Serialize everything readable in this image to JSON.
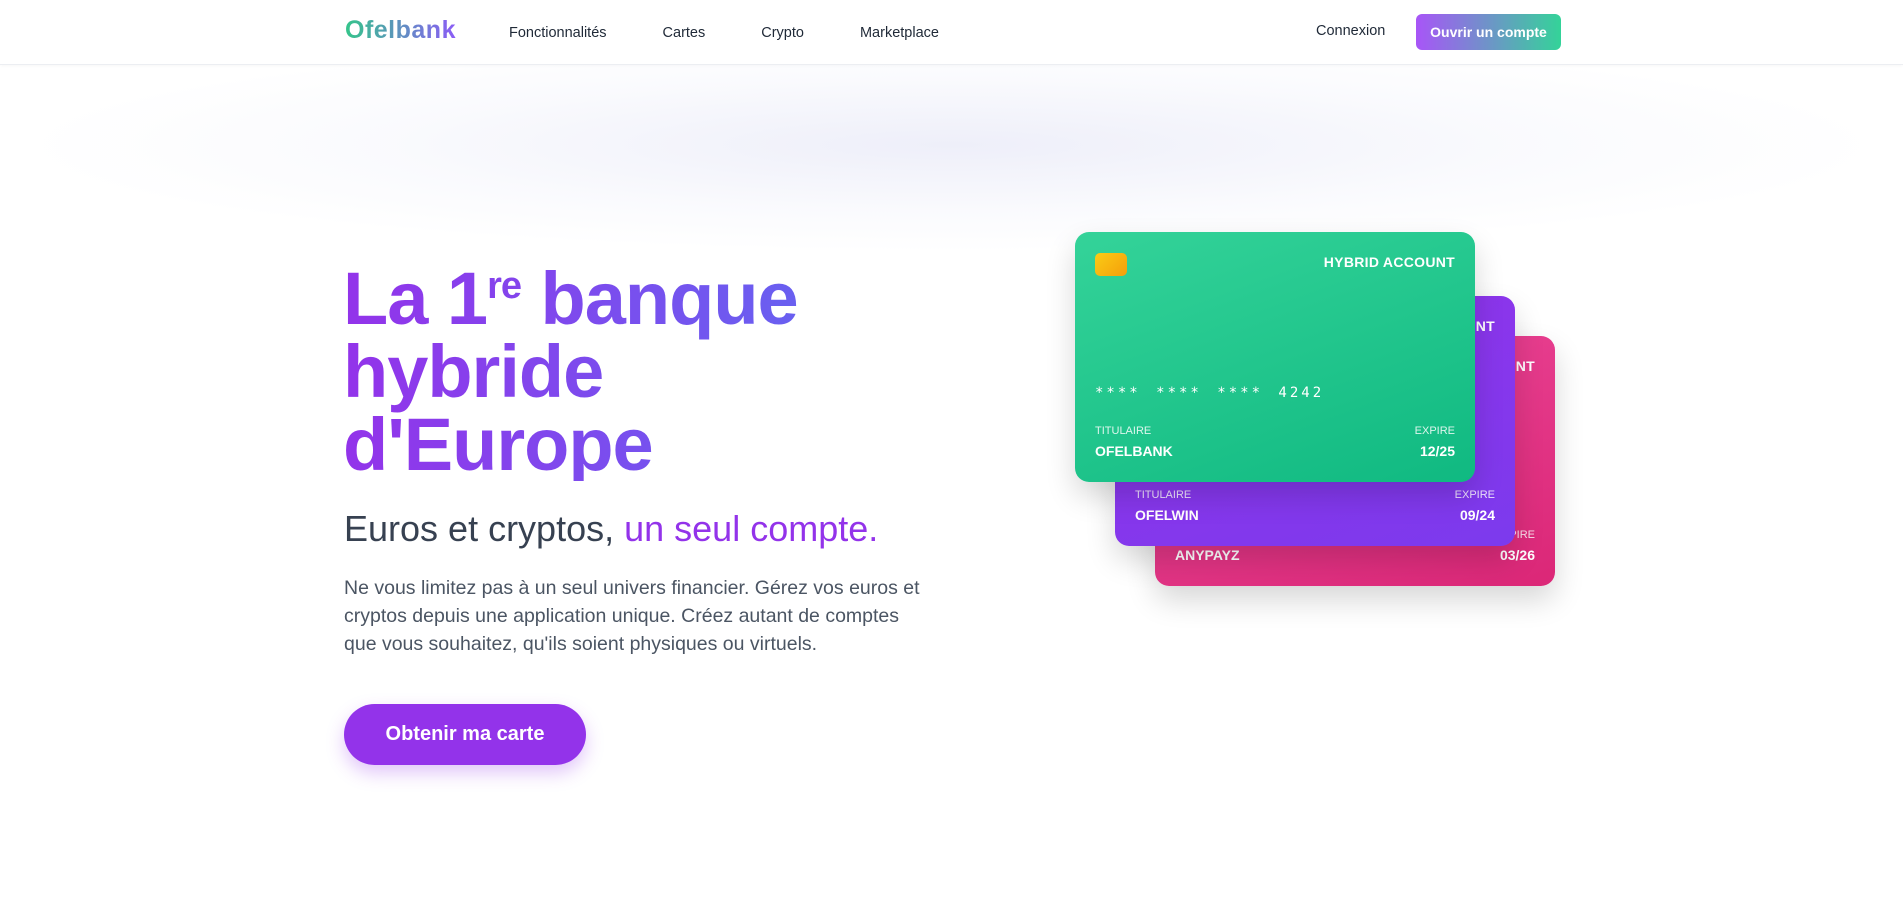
{
  "header": {
    "logo": "Ofelbank",
    "nav": [
      "Fonctionnalités",
      "Cartes",
      "Crypto",
      "Marketplace"
    ],
    "login_label": "Connexion",
    "open_account_label": "Ouvrir un compte"
  },
  "hero": {
    "title_line1_pre": "La 1",
    "title_line1_sup": "re",
    "title_line1_post": " banque",
    "title_line2": "hybride",
    "title_line3": "d'Europe",
    "subtitle_plain": "Euros et cryptos, ",
    "subtitle_accent": "un seul compte.",
    "description": "Ne vous limitez pas à un seul univers financier. Gérez vos euros et cryptos depuis une application unique. Créez autant de comptes que vous souhaitez, qu'ils soient physiques ou virtuels.",
    "cta_label": "Obtenir ma carte"
  },
  "cards": [
    {
      "type": "HYBRID ACCOUNT",
      "number": "**** **** **** 4242",
      "holder_label": "TITULAIRE",
      "holder": "OFELBANK",
      "expire_label": "EXPIRE",
      "expire": "12/25",
      "color": "#10b981"
    },
    {
      "type": "NT",
      "holder_label": "TITULAIRE",
      "holder": "OFELWIN",
      "expire_label": "EXPIRE",
      "expire": "09/24",
      "color": "#9333ea"
    },
    {
      "type": "NT",
      "holder": "ANYPAYZ",
      "expire_label": "PIRE",
      "expire": "03/26",
      "color": "#db2777"
    }
  ],
  "colors": {
    "brand_purple": "#9333ea",
    "brand_green": "#34d399",
    "indigo": "#6366f1"
  }
}
